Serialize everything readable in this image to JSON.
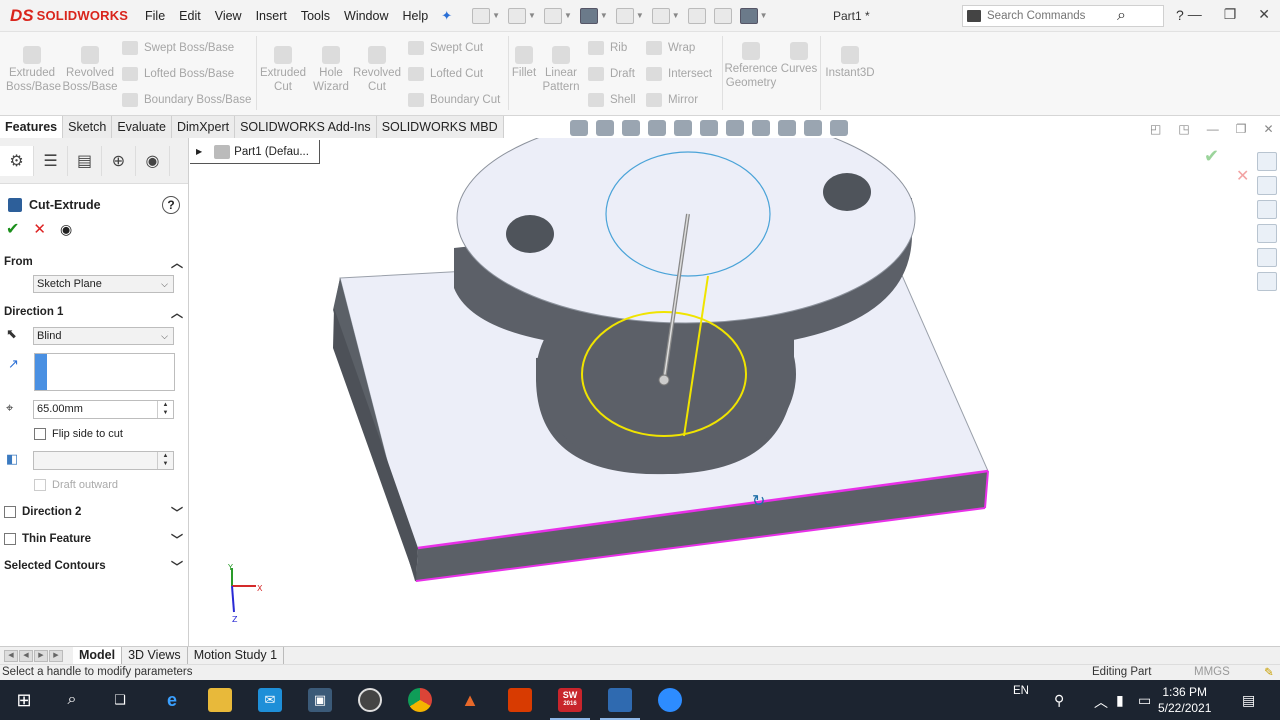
{
  "app": {
    "brand_mark": "DS",
    "brand_name": "SOLIDWORKS",
    "document_title": "Part1 *",
    "menus": [
      "File",
      "Edit",
      "View",
      "Insert",
      "Tools",
      "Window",
      "Help"
    ],
    "search_placeholder": "Search Commands",
    "help_glyph": "?"
  },
  "command_manager": {
    "extruded_boss": "Extruded\nBoss/Base",
    "revolved_boss": "Revolved\nBoss/Base",
    "swept_boss": "Swept Boss/Base",
    "lofted_boss": "Lofted Boss/Base",
    "boundary_boss": "Boundary Boss/Base",
    "extruded_cut": "Extruded\nCut",
    "hole_wizard": "Hole\nWizard",
    "revolved_cut": "Revolved\nCut",
    "swept_cut": "Swept Cut",
    "lofted_cut": "Lofted Cut",
    "boundary_cut": "Boundary Cut",
    "fillet": "Fillet",
    "linear_pattern": "Linear\nPattern",
    "rib": "Rib",
    "draft": "Draft",
    "shell": "Shell",
    "wrap": "Wrap",
    "intersect": "Intersect",
    "mirror": "Mirror",
    "reference_geometry": "Reference\nGeometry",
    "curves": "Curves",
    "instant3d": "Instant3D"
  },
  "tabs": [
    {
      "label": "Features",
      "active": true
    },
    {
      "label": "Sketch",
      "active": false
    },
    {
      "label": "Evaluate",
      "active": false
    },
    {
      "label": "DimXpert",
      "active": false
    },
    {
      "label": "SOLIDWORKS Add-Ins",
      "active": false
    },
    {
      "label": "SOLIDWORKS MBD",
      "active": false
    }
  ],
  "property_manager": {
    "title": "Cut-Extrude",
    "from_label": "From",
    "from_value": "Sketch Plane",
    "direction1_label": "Direction 1",
    "end_condition": "Blind",
    "depth": "65.00mm",
    "flip_side_label": "Flip side to cut",
    "draft_outward_label": "Draft outward",
    "direction2_label": "Direction 2",
    "thin_feature_label": "Thin Feature",
    "selected_contours_label": "Selected Contours"
  },
  "viewport": {
    "breadcrumb": "Part1  (Defau...",
    "triad_x": "X",
    "triad_y": "Y",
    "triad_z": "Z"
  },
  "bottom_tabs": [
    {
      "label": "Model",
      "active": true
    },
    {
      "label": "3D Views",
      "active": false
    },
    {
      "label": "Motion Study 1",
      "active": false
    }
  ],
  "status": {
    "message": "Select a handle to modify parameters",
    "mode": "Editing Part",
    "units": "MMGS"
  },
  "taskbar": {
    "lang": "EN",
    "time": "1:36 PM",
    "date": "5/22/2021",
    "sw_badge": "SW",
    "sw_year": "2016"
  },
  "colors": {
    "brand_red": "#d9251c",
    "model_face": "#eceef8",
    "model_side": "#5b6067",
    "selected_edge": "#e830e8",
    "profile_circle": "#f0e400",
    "sketch_circle": "#4aa3d8",
    "taskbar_bg": "#1c2430"
  }
}
